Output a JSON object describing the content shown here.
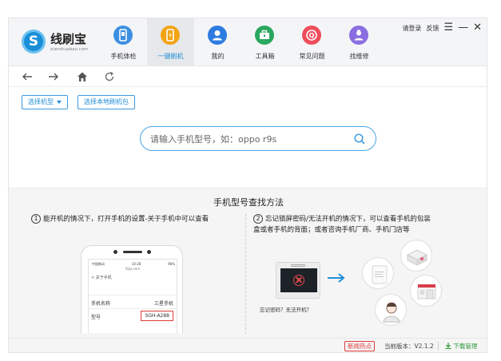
{
  "brand": {
    "name": "线刷宝",
    "sub": "xianshuabao.com"
  },
  "nav": [
    {
      "label": "手机体检",
      "icon": "phone-check-icon",
      "color": "#3d8fe0",
      "active": false
    },
    {
      "label": "一键刷机",
      "icon": "one-click-flash-icon",
      "color": "#f2a413",
      "active": true
    },
    {
      "label": "我的",
      "icon": "user-icon",
      "color": "#2d7be0",
      "active": false
    },
    {
      "label": "工具箱",
      "icon": "toolbox-icon",
      "color": "#2ba85f",
      "active": false
    },
    {
      "label": "常见问题",
      "icon": "question-icon",
      "color": "#ef4d5b",
      "active": false
    },
    {
      "label": "找维修",
      "icon": "repair-icon",
      "color": "#8a6ee0",
      "active": false
    }
  ],
  "window": {
    "login": "请登录",
    "feedback": "反馈",
    "menu": "☰",
    "minimize": "—",
    "close": "✕"
  },
  "toolbar": {
    "select_model": "选择机型",
    "local_package": "选择本地刷机包"
  },
  "search": {
    "placeholder": "请输入手机型号，如：oppo r9s"
  },
  "help": {
    "title": "手机型号查找方法",
    "step1_num": "1",
    "step1": "能开机的情况下，打开手机的设置-关于手机中可以查看",
    "step2_num": "2",
    "step2_line1": "忘记锁屏密码/无法开机的情况下，可以查看手机的包装",
    "step2_line2": "盒或者手机的背面；或者咨询手机厂商、手机门店等",
    "phone": {
      "status_left": "中国移动",
      "status_time": "10:28",
      "status_right": "96%",
      "url": "5bjo.com",
      "back": "< 关于手机",
      "rows": [
        {
          "key": "手机名称",
          "value": "三星手机",
          "boxed": false
        },
        {
          "key": "型号",
          "value": "SGH-A288",
          "boxed": true
        }
      ]
    },
    "laptop_caption": "忘记密码？无法开机？"
  },
  "status": {
    "hot": "新闻热点",
    "version": "当前版本：V2.1.2",
    "download": "下载管理"
  },
  "colors": {
    "accent": "#1f8ed6",
    "hot": "#e23b3b",
    "download": "#2c9a3a"
  }
}
